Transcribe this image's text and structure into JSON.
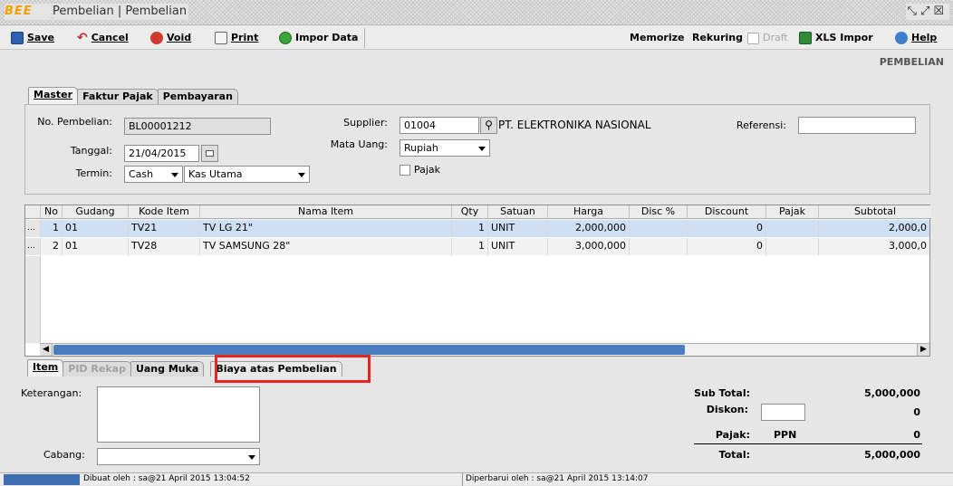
{
  "window": {
    "brand": "BEE",
    "title": "Pembelian | Pembelian",
    "controls": "↗↗☒"
  },
  "toolbar": {
    "save": "Save",
    "cancel": "Cancel",
    "void": "Void",
    "print": "Print",
    "import_data": "Impor Data",
    "memorize": "Memorize",
    "rekuring": "Rekuring",
    "draft": "Draft",
    "xls_import": "XLS Impor",
    "help": "Help"
  },
  "header_label": "PEMBELIAN",
  "tabs_top": [
    {
      "label": "Master",
      "active": true
    },
    {
      "label": "Faktur Pajak",
      "active": false
    },
    {
      "label": "Pembayaran",
      "active": false
    }
  ],
  "form": {
    "no_pembelian_label": "No. Pembelian:",
    "no_pembelian": "BL00001212",
    "tanggal_label": "Tanggal:",
    "tanggal": "21/04/2015",
    "termin_label": "Termin:",
    "termin": "Cash",
    "kas": "Kas Utama",
    "supplier_label": "Supplier:",
    "supplier_code": "01004",
    "supplier_name": "PT. ELEKTRONIKA NASIONAL",
    "mata_uang_label": "Mata Uang:",
    "mata_uang": "Rupiah",
    "pajak_label": "Pajak",
    "referensi_label": "Referensi:",
    "referensi": ""
  },
  "grid": {
    "columns": [
      "No",
      "Gudang",
      "Kode Item",
      "Nama Item",
      "Qty",
      "Satuan",
      "Harga",
      "Disc %",
      "Discount",
      "Pajak",
      "Subtotal"
    ],
    "rows": [
      {
        "no": "1",
        "gudang": "01",
        "kode": "TV21",
        "nama": "TV LG 21\"",
        "qty": "1",
        "satuan": "UNIT",
        "harga": "2,000,000",
        "disc": "",
        "discount": "0",
        "pajak": "",
        "subtotal": "2,000,0"
      },
      {
        "no": "2",
        "gudang": "01",
        "kode": "TV28",
        "nama": "TV SAMSUNG 28\"",
        "qty": "1",
        "satuan": "UNIT",
        "harga": "3,000,000",
        "disc": "",
        "discount": "0",
        "pajak": "",
        "subtotal": "3,000,0"
      }
    ]
  },
  "tabs_bottom": [
    {
      "label": "Item",
      "active": true
    },
    {
      "label": "PID Rekap",
      "disabled": true
    },
    {
      "label": "Uang Muka"
    },
    {
      "label": "Biaya atas Pembelian",
      "highlighted": true
    }
  ],
  "footer": {
    "keterangan_label": "Keterangan:",
    "cabang_label": "Cabang:",
    "sub_total_label": "Sub Total:",
    "sub_total": "5,000,000",
    "diskon_label": "Diskon:",
    "diskon": "0",
    "pajak_label": "Pajak:",
    "pajak_type": "PPN",
    "pajak": "0",
    "total_label": "Total:",
    "total": "5,000,000"
  },
  "status": {
    "created": "Dibuat oleh : sa@21 April 2015  13:04:52",
    "updated": "Diperbarui oleh : sa@21 April 2015  13:14:07"
  },
  "colors": {
    "highlight_box": "#e8251f",
    "selected_row": "#cfe0f5",
    "scrollbar": "#4a7cc0"
  }
}
